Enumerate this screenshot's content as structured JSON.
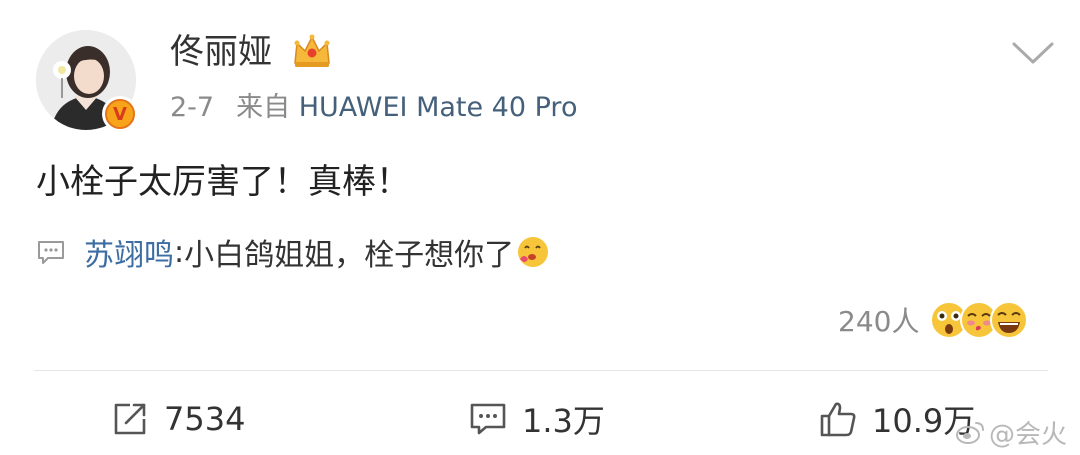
{
  "post": {
    "author": "佟丽娅",
    "date": "2-7",
    "source_prefix": "来自",
    "source_device": "HUAWEI Mate 40 Pro",
    "text": "小栓子太厉害了！真棒！"
  },
  "comment": {
    "author": "苏翊鸣",
    "separator": ":",
    "text": " 小白鸽姐姐，栓子想你了"
  },
  "reactions": {
    "count": "240人",
    "icons": [
      "shocked-face",
      "kiss-face",
      "laughing-face"
    ]
  },
  "actions": {
    "repost": "7534",
    "comments": "1.3万",
    "likes": "10.9万"
  },
  "watermark": "@会火",
  "colors": {
    "link": "#3d6da3",
    "source": "#45607a",
    "muted": "#8a8a8a",
    "emoji_yellow": "#f7c53a"
  }
}
